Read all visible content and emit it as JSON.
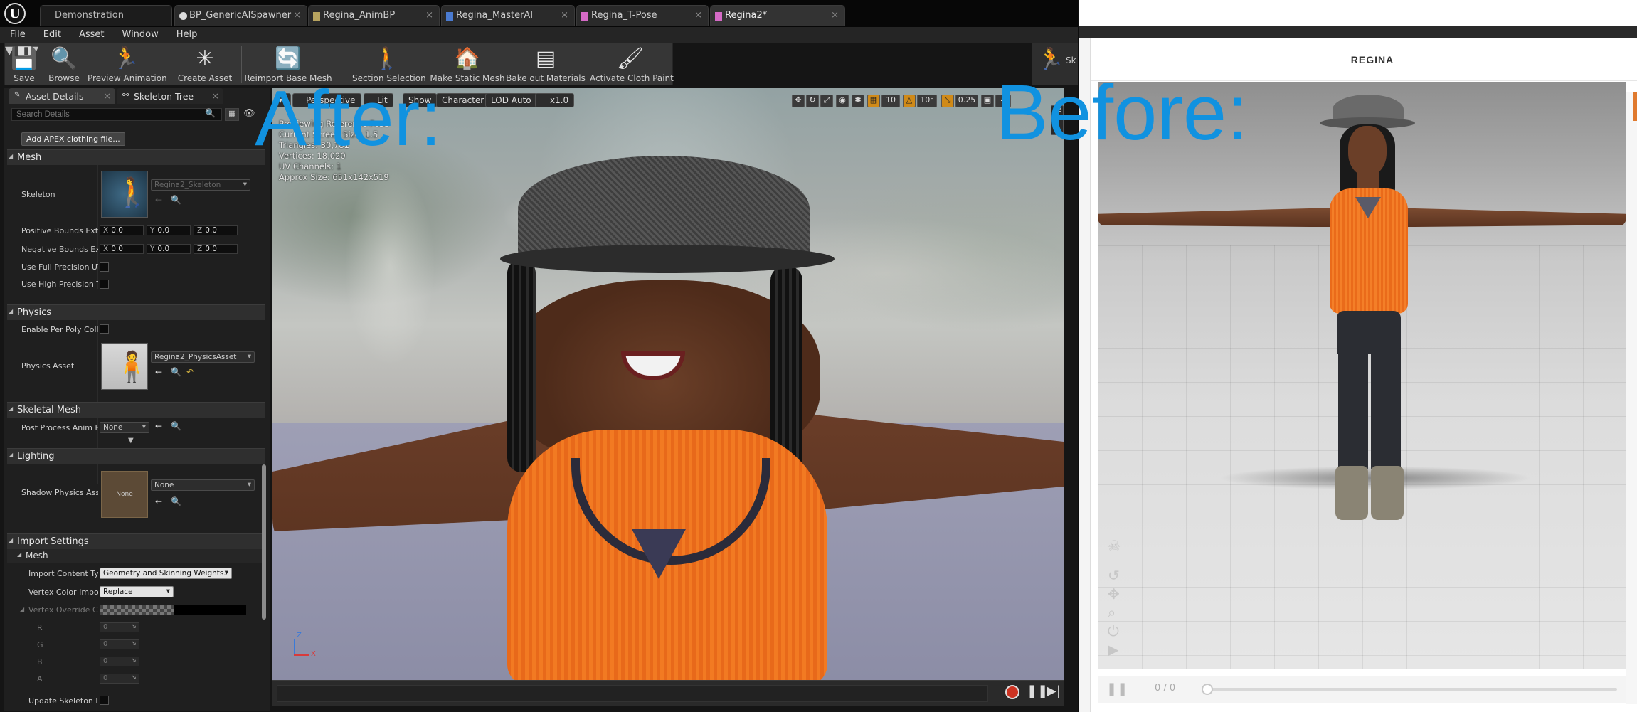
{
  "editor": {
    "tabs": [
      {
        "label": "Demonstration"
      },
      {
        "label": "BP_GenericAISpawner"
      },
      {
        "label": "Regina_AnimBP"
      },
      {
        "label": "Regina_MasterAI"
      },
      {
        "label": "Regina_T-Pose"
      },
      {
        "label": "Regina2*"
      }
    ],
    "menu": [
      "File",
      "Edit",
      "Asset",
      "Window",
      "Help"
    ],
    "toolbar": [
      {
        "label": "Save",
        "icon": "save-icon"
      },
      {
        "label": "Browse",
        "icon": "browse-icon"
      },
      {
        "label": "Preview Animation",
        "icon": "skeleton-icon"
      },
      {
        "label": "Create Asset",
        "icon": "create-asset-icon"
      },
      {
        "label": "Reimport Base Mesh",
        "icon": "reimport-icon"
      },
      {
        "label": "Section Selection",
        "icon": "section-selection-icon"
      },
      {
        "label": "Make Static Mesh",
        "icon": "static-mesh-icon"
      },
      {
        "label": "Bake out Materials",
        "icon": "layers-icon"
      },
      {
        "label": "Activate Cloth Paint",
        "icon": "brush-icon"
      }
    ],
    "toolbar_right_stub": "Sk",
    "panel_tabs": {
      "asset_details": "Asset Details",
      "skeleton_tree": "Skeleton Tree"
    },
    "details": {
      "search_placeholder": "Search Details",
      "apex_button": "Add APEX clothing file...",
      "mesh": {
        "header": "Mesh",
        "skeleton_label": "Skeleton",
        "skeleton_value": "Regina2_Skeleton",
        "pos_bounds_label": "Positive Bounds Exte",
        "neg_bounds_label": "Negative Bounds Ext",
        "x": "0.0",
        "y": "0.0",
        "z": "0.0",
        "full_precision_label": "Use Full Precision UV",
        "high_precision_label": "Use High Precision T"
      },
      "physics": {
        "header": "Physics",
        "per_poly_label": "Enable Per Poly Colli",
        "asset_label": "Physics Asset",
        "asset_value": "Regina2_PhysicsAsset"
      },
      "skeletal_mesh": {
        "header": "Skeletal Mesh",
        "post_process_label": "Post Process Anim E",
        "post_process_value": "None"
      },
      "lighting": {
        "header": "Lighting",
        "shadow_label": "Shadow Physics Ass",
        "shadow_thumb": "None",
        "shadow_value": "None"
      },
      "import": {
        "header": "Import Settings",
        "mesh_header": "Mesh",
        "content_type_label": "Import Content Typ",
        "content_type_value": "Geometry and Skinning Weights.",
        "vertex_color_label": "Vertex Color Impor",
        "vertex_color_value": "Replace",
        "override_label": "Vertex Override Co",
        "r": "R",
        "g": "G",
        "b": "B",
        "a": "A",
        "rgba_value": "0",
        "update_skeleton_label": "Update Skeleton Re"
      }
    },
    "viewport": {
      "perspective": "Perspective",
      "lit": "Lit",
      "show": "Show",
      "character": "Character",
      "lod": "LOD Auto",
      "speed": "x1.0",
      "grid_value": "10",
      "angle_value": "10°",
      "scale_value": "0.25",
      "cam_value": "4",
      "preview_text": "Previewing Reference Pose",
      "screen_size": "Current Screen Size: 1.5",
      "triangles": "Triangles: 30,781",
      "vertices": "Vertices: 18,020",
      "uv_channels": "UV Channels: 1",
      "approx_size": "Approx Size: 651x142x519",
      "axis_z": "Z",
      "axis_x": "X",
      "side_stub": "Re"
    }
  },
  "overlay": {
    "after": "After:",
    "before": "Before:"
  },
  "preview": {
    "title": "REGINA",
    "counter": "0 / 0"
  },
  "colors": {
    "overlay_text": "#1192e0",
    "shirt": "#f0741a",
    "editor_bg": "#151515"
  }
}
